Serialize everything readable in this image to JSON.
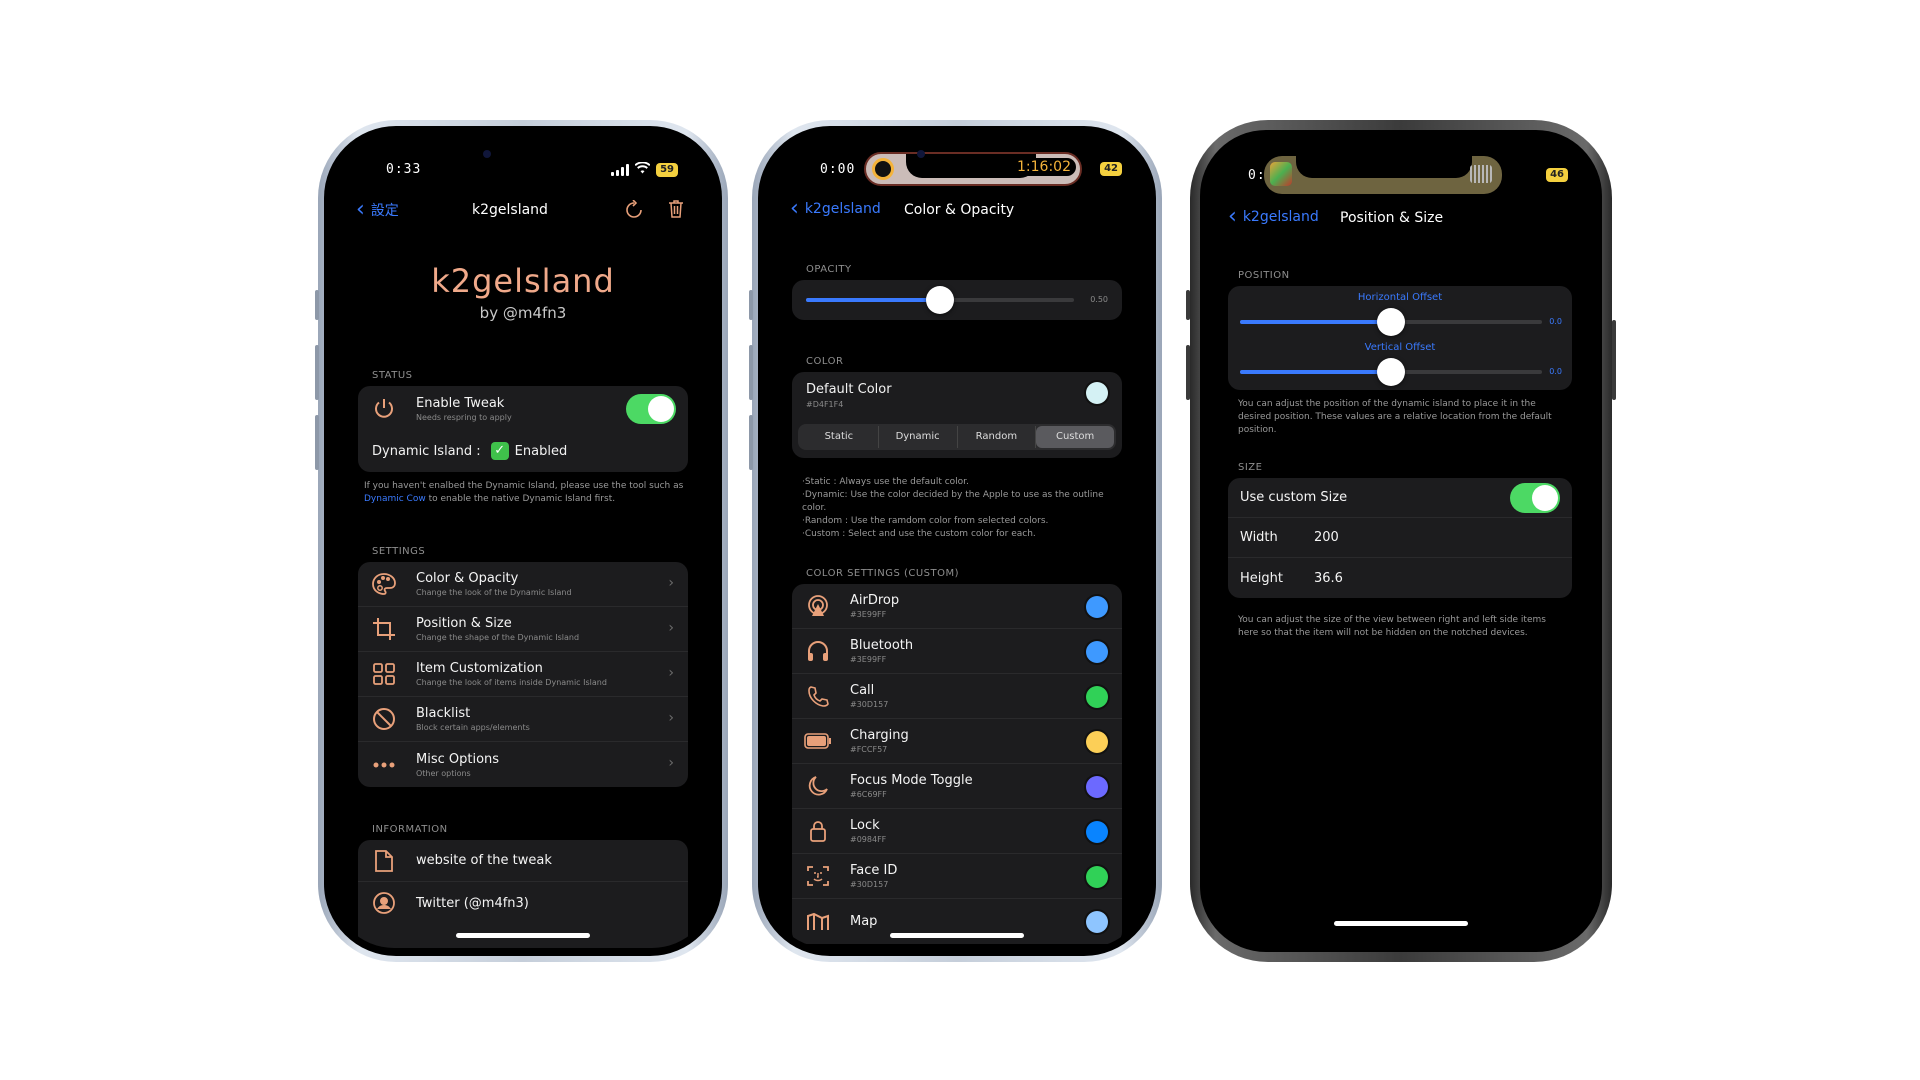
{
  "phone1": {
    "status": {
      "time": "0:33",
      "battery": "59"
    },
    "nav": {
      "back_label": "設定",
      "title": "k2gelsland",
      "refresh_icon": "refresh-icon",
      "trash_icon": "trash-icon"
    },
    "hero": {
      "title": "k2gelsland",
      "subtitle": "by @m4fn3"
    },
    "status_section": {
      "label": "STATUS",
      "enable_tweak": {
        "title": "Enable Tweak",
        "subtitle": "Needs respring to apply",
        "on": true
      },
      "dynamic_island_label": "Dynamic Island :",
      "dynamic_island_value": "Enabled",
      "footnote_pre": "If you haven't enalbed the Dynamic Island, please use the tool such as ",
      "footnote_link": "Dynamic Cow",
      "footnote_post": " to enable the native Dynamic Island first."
    },
    "settings": {
      "label": "SETTINGS",
      "items": [
        {
          "title": "Color & Opacity",
          "subtitle": "Change the look of the Dynamic Island",
          "icon": "palette-icon"
        },
        {
          "title": "Position & Size",
          "subtitle": "Change the shape of the Dynamic Island",
          "icon": "crop-icon"
        },
        {
          "title": "Item Customization",
          "subtitle": "Change the look of items inside Dynamic Island",
          "icon": "grid-icon"
        },
        {
          "title": "Blacklist",
          "subtitle": "Block certain apps/elements",
          "icon": "prohibited-icon"
        },
        {
          "title": "Misc Options",
          "subtitle": "Other options",
          "icon": "ellipsis-icon"
        }
      ]
    },
    "information": {
      "label": "INFORMATION",
      "items": [
        {
          "title": "website of the tweak",
          "icon": "document-icon"
        },
        {
          "title": "Twitter (@m4fn3)",
          "icon": "person-icon"
        }
      ]
    }
  },
  "phone2": {
    "status": {
      "time": "0:00",
      "island_timer": "1:16:02",
      "battery": "42"
    },
    "nav": {
      "back_label": "k2gelsland",
      "title": "Color & Opacity"
    },
    "opacity": {
      "label": "OPACITY",
      "value": 0.5,
      "value_text": "0.50"
    },
    "color": {
      "label": "COLOR",
      "default_color": {
        "title": "Default Color",
        "hex": "#D4F1F4",
        "swatch": "#D4F1F4"
      },
      "modes": [
        "Static",
        "Dynamic",
        "Random",
        "Custom"
      ],
      "selected_mode": "Custom",
      "notes": [
        "·Static : Always use the default color.",
        "·Dynamic: Use the color decided by the Apple to use as the outline color.",
        "·Random : Use the ramdom color from selected colors.",
        "·Custom : Select and use the custom color for each."
      ]
    },
    "color_settings": {
      "label": "COLOR SETTINGS (CUSTOM)",
      "items": [
        {
          "title": "AirDrop",
          "hex": "#3E99FF",
          "swatch": "#3E99FF",
          "icon": "airdrop-icon"
        },
        {
          "title": "Bluetooth",
          "hex": "#3E99FF",
          "swatch": "#3E99FF",
          "icon": "headphones-icon"
        },
        {
          "title": "Call",
          "hex": "#30D157",
          "swatch": "#30D157",
          "icon": "phone-icon"
        },
        {
          "title": "Charging",
          "hex": "#FCCF57",
          "swatch": "#FCCF57",
          "icon": "battery-icon"
        },
        {
          "title": "Focus Mode Toggle",
          "hex": "#6C69FF",
          "swatch": "#6C69FF",
          "icon": "moon-icon"
        },
        {
          "title": "Lock",
          "hex": "#0984FF",
          "swatch": "#0984FF",
          "icon": "lock-icon"
        },
        {
          "title": "Face ID",
          "hex": "#30D157",
          "swatch": "#30D157",
          "icon": "faceid-icon"
        },
        {
          "title": "Map",
          "hex": "",
          "swatch": "#8EC5FF",
          "icon": "map-icon"
        }
      ]
    }
  },
  "phone3": {
    "status": {
      "time": "0:",
      "battery": "46"
    },
    "nav": {
      "back_label": "k2gelsland",
      "title": "Position & Size"
    },
    "position": {
      "label": "POSITION",
      "horizontal": {
        "label": "Horizontal Offset",
        "value": 0.0,
        "value_text": "0.0",
        "fraction": 0.5
      },
      "vertical": {
        "label": "Vertical Offset",
        "value": 0.0,
        "value_text": "0.0",
        "fraction": 0.5
      },
      "footnote": "You can adjust the position of the dynamic island to place it in the desired position. These values are a relative location from the default position."
    },
    "size": {
      "label": "SIZE",
      "use_custom": {
        "label": "Use custom Size",
        "on": true
      },
      "width": {
        "label": "Width",
        "value": "200"
      },
      "height": {
        "label": "Height",
        "value": "36.6"
      },
      "footnote": "You can adjust the size of the view between right and left side items here so that the item will not be hidden on the notched devices."
    }
  },
  "colors": {
    "accent_blue": "#3A7AFE",
    "icon_peach": "#E8A07A",
    "toggle_green": "#4CD964",
    "card_bg": "#1C1C1E"
  }
}
